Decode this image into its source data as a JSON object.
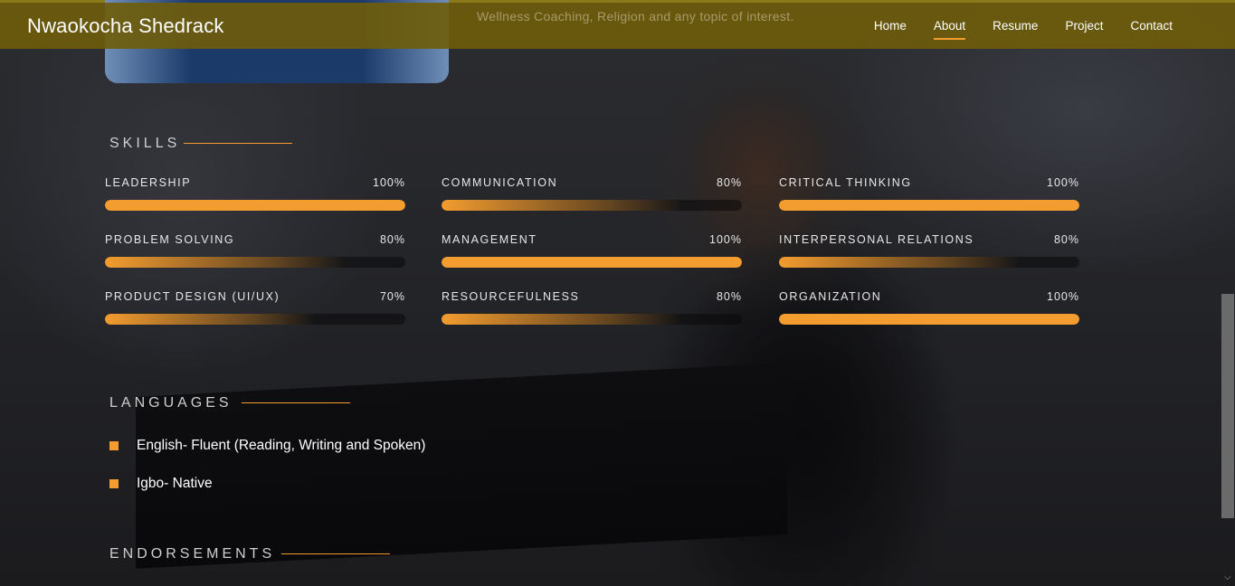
{
  "header": {
    "brand": "Nwaokocha Shedrack",
    "nav": [
      {
        "label": "Home",
        "active": false
      },
      {
        "label": "About",
        "active": true
      },
      {
        "label": "Resume",
        "active": false
      },
      {
        "label": "Project",
        "active": false
      },
      {
        "label": "Contact",
        "active": false
      }
    ]
  },
  "intro_tail": "Wellness Coaching, Religion and any topic of interest.",
  "skills": {
    "title": "SKILLS",
    "items": [
      {
        "name": "LEADERSHIP",
        "percent": "100%",
        "level": 100
      },
      {
        "name": "COMMUNICATION",
        "percent": "80%",
        "level": 80
      },
      {
        "name": "CRITICAL THINKING",
        "percent": "100%",
        "level": 100
      },
      {
        "name": "PROBLEM SOLVING",
        "percent": "80%",
        "level": 80
      },
      {
        "name": "MANAGEMENT",
        "percent": "100%",
        "level": 100
      },
      {
        "name": "INTERPERSONAL RELATIONS",
        "percent": "80%",
        "level": 80
      },
      {
        "name": "PRODUCT DESIGN (UI/UX)",
        "percent": "70%",
        "level": 70
      },
      {
        "name": "RESOURCEFULNESS",
        "percent": "80%",
        "level": 80
      },
      {
        "name": "ORGANIZATION",
        "percent": "100%",
        "level": 100
      }
    ]
  },
  "languages": {
    "title": "LANGUAGES",
    "items": [
      "English- Fluent (Reading, Writing and Spoken)",
      "Igbo- Native"
    ]
  },
  "endorsements": {
    "title": "ENDORSEMENTS"
  },
  "colors": {
    "accent": "#f39c2f",
    "header_bg": "#6e5c0c"
  }
}
